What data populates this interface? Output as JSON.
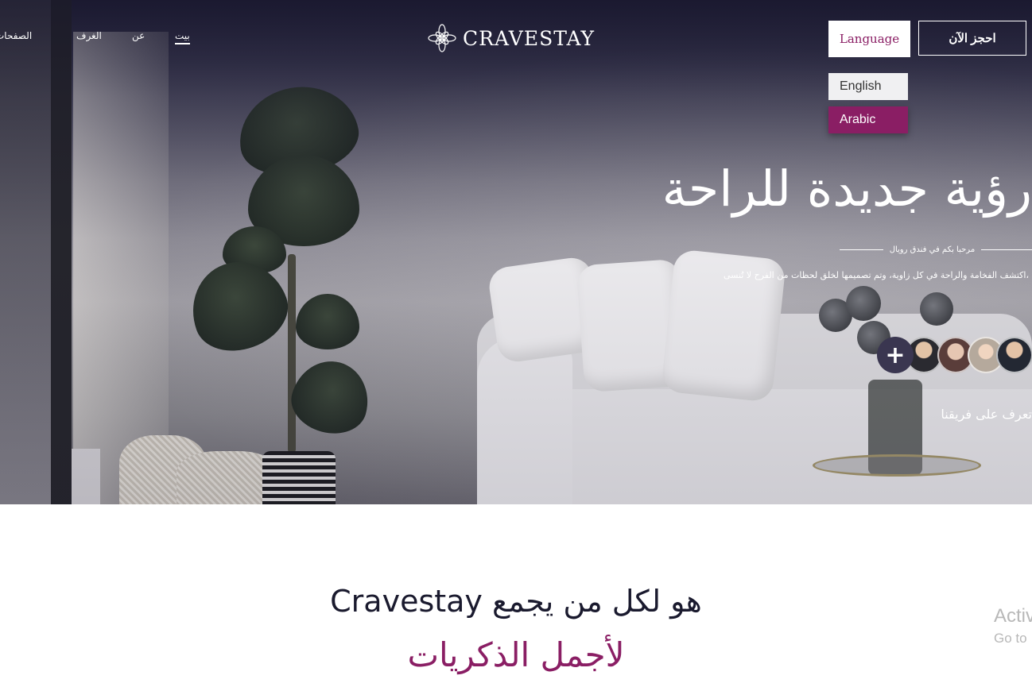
{
  "nav": {
    "items": [
      {
        "label": "بيت",
        "active": true
      },
      {
        "label": "عن",
        "active": false
      },
      {
        "label": "الغرف",
        "active": false
      },
      {
        "label": "الصفحات",
        "active": false
      }
    ]
  },
  "brand": {
    "name": "CRAVESTAY"
  },
  "header": {
    "language_label": "Language",
    "book_label": "احجز الآن"
  },
  "language_menu": {
    "options": [
      "English",
      "Arabic"
    ],
    "highlighted": "Arabic"
  },
  "hero": {
    "title": "رؤية جديدة للراحة",
    "subtitle": "مرحبا بكم في فندق رويال",
    "description": "اكتشف الفخامة والراحة في كل زاوية، وتم تصميمها لخلق لحظات من الفرح لا تُنسى،",
    "plus_symbol": "+",
    "team_link": "تعرف على فريقنا"
  },
  "about": {
    "heading": "Cravestay هو لكل من يجمع",
    "subheading": "لأجمل الذكريات"
  },
  "watermark": {
    "line1": "Activ",
    "line2": "Go to"
  },
  "colors": {
    "accent": "#8a1e64",
    "dark": "#1a1a2e"
  }
}
